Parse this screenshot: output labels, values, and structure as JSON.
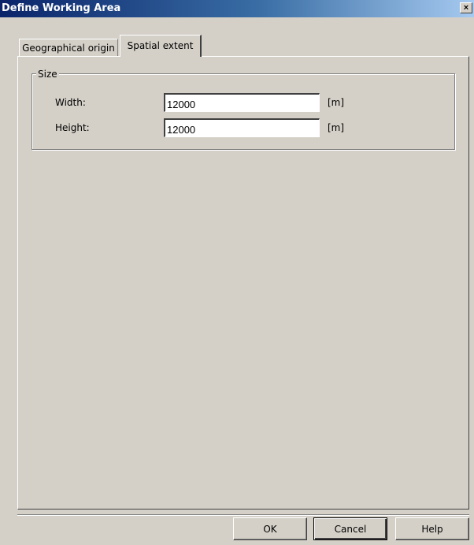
{
  "window": {
    "title": "Define Working Area",
    "close_glyph": "×"
  },
  "tabs": [
    {
      "label": "Geographical origin",
      "active": false
    },
    {
      "label": "Spatial extent",
      "active": true
    }
  ],
  "size_group": {
    "label": "Size",
    "fields": [
      {
        "label": "Width:",
        "value": "12000",
        "unit": "[m]"
      },
      {
        "label": "Height:",
        "value": "12000",
        "unit": "[m]"
      }
    ]
  },
  "buttons": {
    "ok": "OK",
    "cancel": "Cancel",
    "help": "Help"
  },
  "colors": {
    "title_gradient_start": "#0a246a",
    "title_gradient_end": "#a6caf0",
    "dialog_face": "#d4d0c8"
  }
}
